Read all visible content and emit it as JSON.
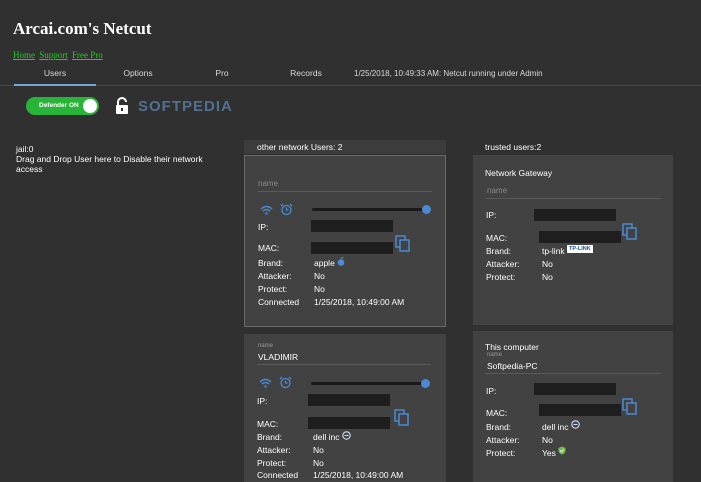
{
  "app": {
    "title": "Arcai.com's Netcut",
    "links": [
      "Home",
      "Support",
      "Free Pro"
    ]
  },
  "tabs": [
    {
      "label": "Users",
      "active": true
    },
    {
      "label": "Options",
      "active": false
    },
    {
      "label": "Pro",
      "active": false
    },
    {
      "label": "Records",
      "active": false
    }
  ],
  "status_line": "1/25/2018, 10:49:33 AM: Netcut running under Admin",
  "defender": {
    "label": "Defender ON",
    "on": true
  },
  "watermark": "SOFTPEDIA",
  "jail": {
    "title": "jail:0",
    "hint": "Drag and Drop User here to Disable their network access"
  },
  "other_users": {
    "header": "other network Users: 2",
    "cards": [
      {
        "name_placeholder": "name",
        "name": "",
        "ip_label": "IP:",
        "mac_label": "MAC:",
        "brand_label": "Brand:",
        "brand": "apple",
        "attacker_label": "Attacker:",
        "attacker": "No",
        "protect_label": "Protect:",
        "protect": "No",
        "connected_label": "Connected",
        "connected": "1/25/2018, 10:49:00 AM",
        "speed_level": 1.0
      },
      {
        "name_caption": "name",
        "name": "VLADIMIR",
        "ip_label": "IP:",
        "mac_label": "MAC:",
        "brand_label": "Brand:",
        "brand": "dell inc",
        "attacker_label": "Attacker:",
        "attacker": "No",
        "protect_label": "Protect:",
        "protect": "No",
        "connected_label": "Connected",
        "connected": "1/25/2018, 10:49:00 AM",
        "speed_level": 1.0
      }
    ]
  },
  "trusted_users": {
    "header": "trusted users:2",
    "cards": [
      {
        "title": "Network Gateway",
        "name_placeholder": "name",
        "ip_label": "IP:",
        "mac_label": "MAC:",
        "brand_label": "Brand:",
        "brand": "tp-link",
        "brand_logo": "TP-LINK",
        "attacker_label": "Attacker:",
        "attacker": "No",
        "protect_label": "Protect:",
        "protect": "No"
      },
      {
        "title": "This computer",
        "name_caption": "name",
        "name": "Softpedia-PC",
        "ip_label": "IP:",
        "mac_label": "MAC:",
        "brand_label": "Brand:",
        "brand": "dell inc",
        "attacker_label": "Attacker:",
        "attacker": "No",
        "protect_label": "Protect:",
        "protect": "Yes"
      }
    ]
  },
  "colors": {
    "accent": "#28b438",
    "link": "#22cc22",
    "slider": "#4a8ad4",
    "tab_underline": "#6fa8d0"
  },
  "icons": [
    "lock-open-icon",
    "wifi-icon",
    "alarm-clock-icon",
    "copy-icon",
    "apple-icon",
    "minus-circle-icon",
    "shield-check-icon"
  ]
}
